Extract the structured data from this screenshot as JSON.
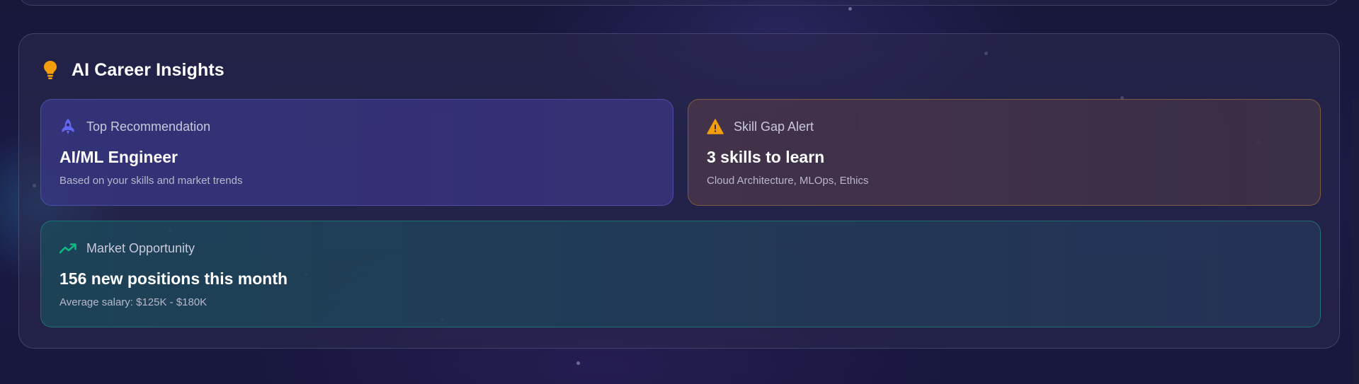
{
  "insights": {
    "title": "AI Career Insights",
    "header_icon": "lightbulb-icon",
    "cards": {
      "recommendation": {
        "icon": "rocket-icon",
        "label": "Top Recommendation",
        "value": "AI/ML Engineer",
        "description": "Based on your skills and market trends",
        "accent": "#6366f1"
      },
      "skill_gap": {
        "icon": "warning-icon",
        "label": "Skill Gap Alert",
        "value": "3 skills to learn",
        "description": "Cloud Architecture, MLOps, Ethics",
        "accent": "#f59e0b"
      },
      "market": {
        "icon": "trending-up-icon",
        "label": "Market Opportunity",
        "value": "156 new positions this month",
        "description": "Average salary: $125K - $180K",
        "accent": "#10b981"
      }
    }
  },
  "colors": {
    "background": "#17173a",
    "lightbulb": "#f59e0b",
    "rocket": "#6366f1",
    "warning": "#f59e0b",
    "trend": "#10b981"
  }
}
